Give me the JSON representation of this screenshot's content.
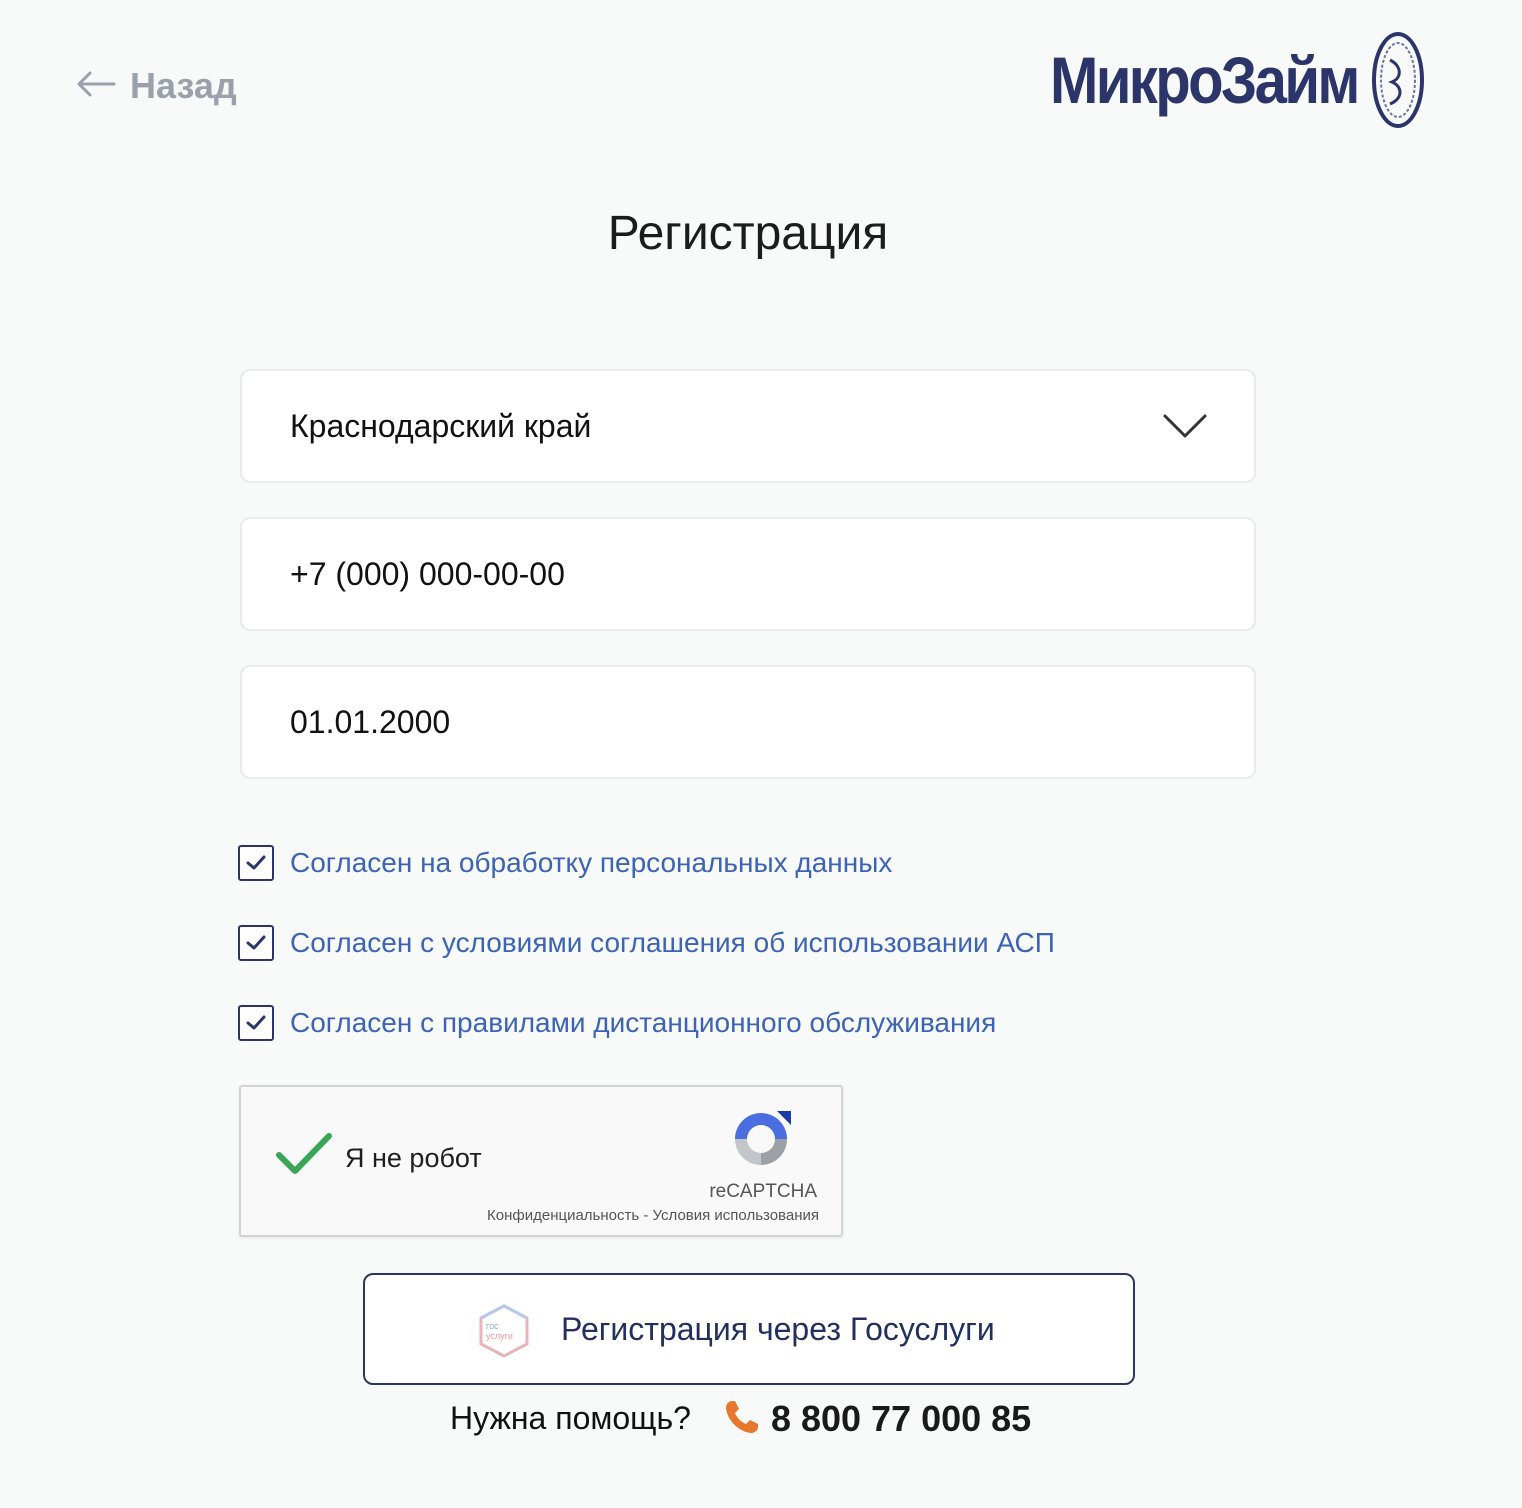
{
  "header": {
    "back_label": "Назад",
    "logo_text": "МикроЗайм"
  },
  "page": {
    "title": "Регистрация"
  },
  "form": {
    "region": {
      "value": "Краснодарский край"
    },
    "phone": {
      "value": "+7 (000) 000-00-00"
    },
    "birthdate": {
      "value": "01.01.2000"
    },
    "agreements": [
      {
        "label": "Согласен на обработку персональных данных",
        "checked": true
      },
      {
        "label": "Согласен с условиями соглашения об использовании АСП",
        "checked": true
      },
      {
        "label": "Согласен с правилами дистанционного обслуживания",
        "checked": true
      }
    ]
  },
  "captcha": {
    "label": "Я не робот",
    "brand": "reCAPTCHA",
    "links": "Конфиденциальность - Условия использования",
    "checked": true
  },
  "gosuslugi": {
    "label": "Регистрация через Госуслуги",
    "icon_text_top": "гос",
    "icon_text_bottom": "услуги"
  },
  "help": {
    "label": "Нужна помощь?",
    "phone": "8 800 77 000 85"
  },
  "colors": {
    "brand": "#2c3569",
    "link": "#3c63b6",
    "muted": "#9aa1ab",
    "success": "#3aa757",
    "phone_icon": "#e8772e"
  }
}
